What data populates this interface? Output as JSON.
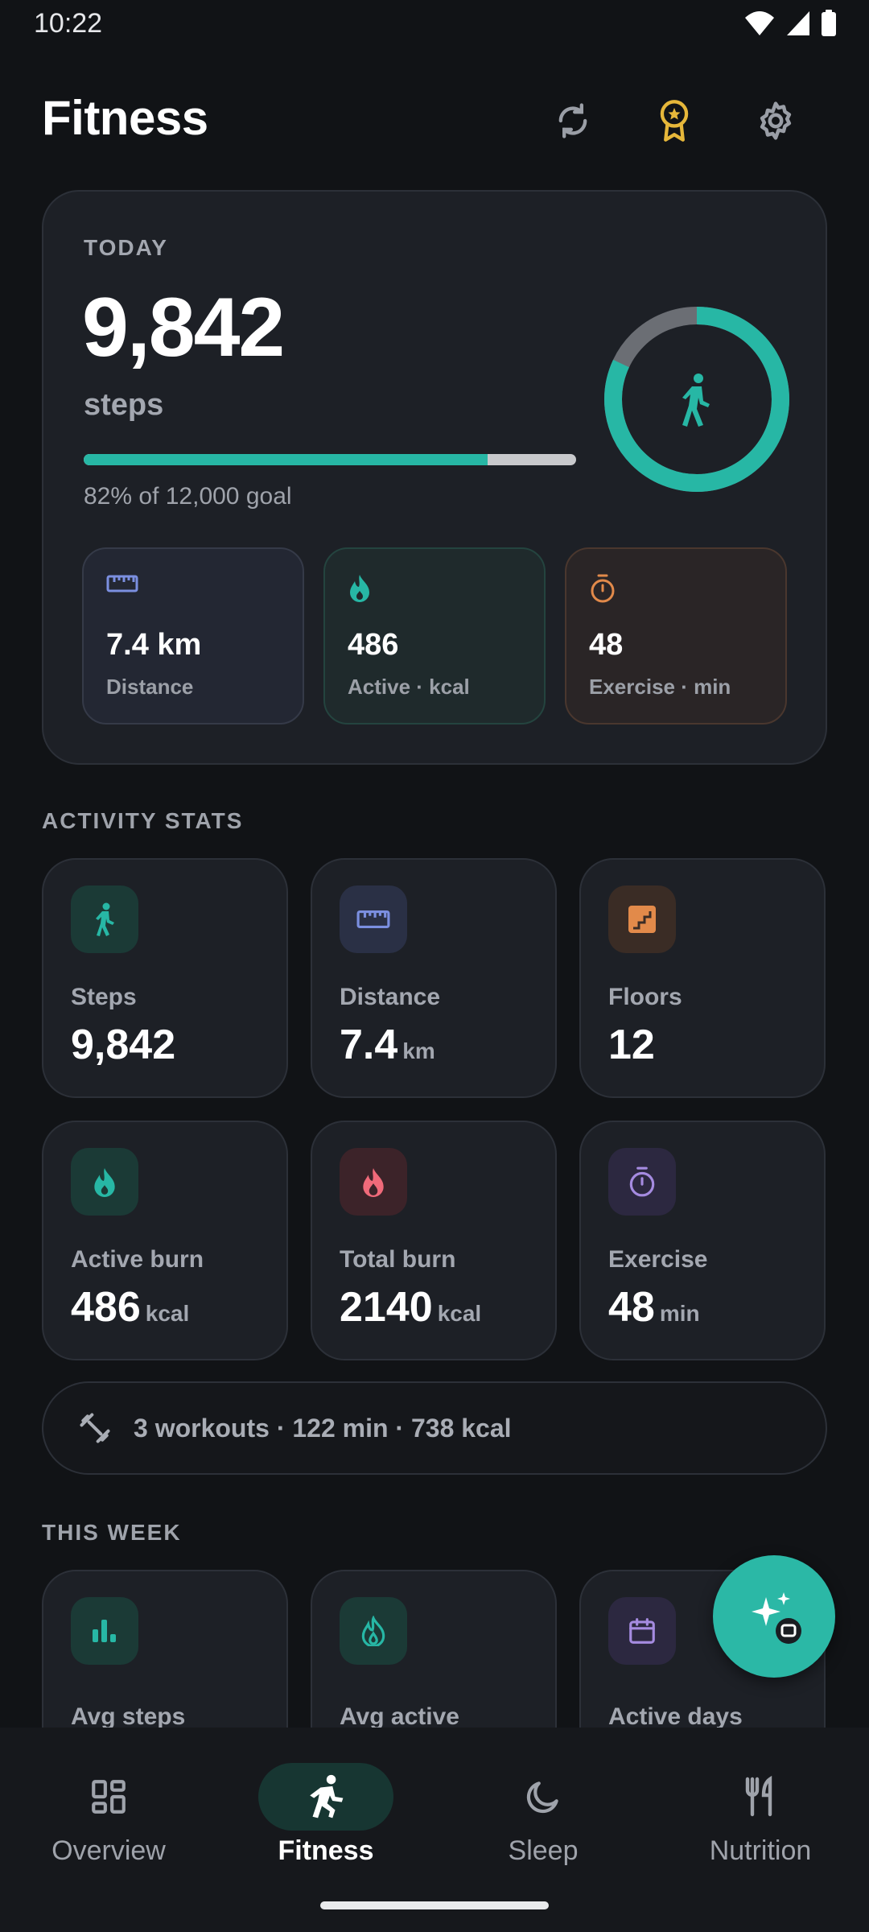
{
  "status_bar": {
    "time": "10:22"
  },
  "header": {
    "title": "Fitness"
  },
  "today": {
    "label": "TODAY",
    "steps": "9,842",
    "unit": "steps",
    "progress": 0.82,
    "goal_text": "82% of 12,000 goal",
    "mini_stats": [
      {
        "value": "7.4 km",
        "label": "Distance",
        "icon": "ruler-icon"
      },
      {
        "value": "486",
        "label": "Active · kcal",
        "icon": "flame-icon"
      },
      {
        "value": "48",
        "label": "Exercise · min",
        "icon": "timer-icon"
      }
    ]
  },
  "activity": {
    "section_label": "ACTIVITY STATS",
    "cards": [
      {
        "label": "Steps",
        "value": "9,842",
        "unit": "",
        "icon": "walk-icon"
      },
      {
        "label": "Distance",
        "value": "7.4",
        "unit": "km",
        "icon": "ruler-icon"
      },
      {
        "label": "Floors",
        "value": "12",
        "unit": "",
        "icon": "stairs-icon"
      },
      {
        "label": "Active burn",
        "value": "486",
        "unit": "kcal",
        "icon": "flame-icon"
      },
      {
        "label": "Total burn",
        "value": "2140",
        "unit": "kcal",
        "icon": "fire-icon"
      },
      {
        "label": "Exercise",
        "value": "48",
        "unit": "min",
        "icon": "timer-icon"
      }
    ],
    "workouts_summary": "3 workouts · 122 min · 738 kcal"
  },
  "week": {
    "section_label": "THIS WEEK",
    "cards": [
      {
        "label": "Avg steps",
        "icon": "bar-chart-icon"
      },
      {
        "label": "Avg active",
        "icon": "flame-icon"
      },
      {
        "label": "Active days",
        "icon": "calendar-icon"
      }
    ]
  },
  "nav": {
    "items": [
      {
        "label": "Overview",
        "icon": "dashboard-icon"
      },
      {
        "label": "Fitness",
        "icon": "run-icon",
        "active": true
      },
      {
        "label": "Sleep",
        "icon": "moon-icon"
      },
      {
        "label": "Nutrition",
        "icon": "fork-knife-icon"
      }
    ]
  },
  "colors": {
    "accent": "#27b7a5",
    "background": "#111316",
    "card": "#1d2026",
    "distance": "#7b8fe0",
    "floors": "#e28a4a",
    "total_burn": "#f06a7a",
    "exercise": "#a58be0",
    "badge": "#e6b73a"
  }
}
